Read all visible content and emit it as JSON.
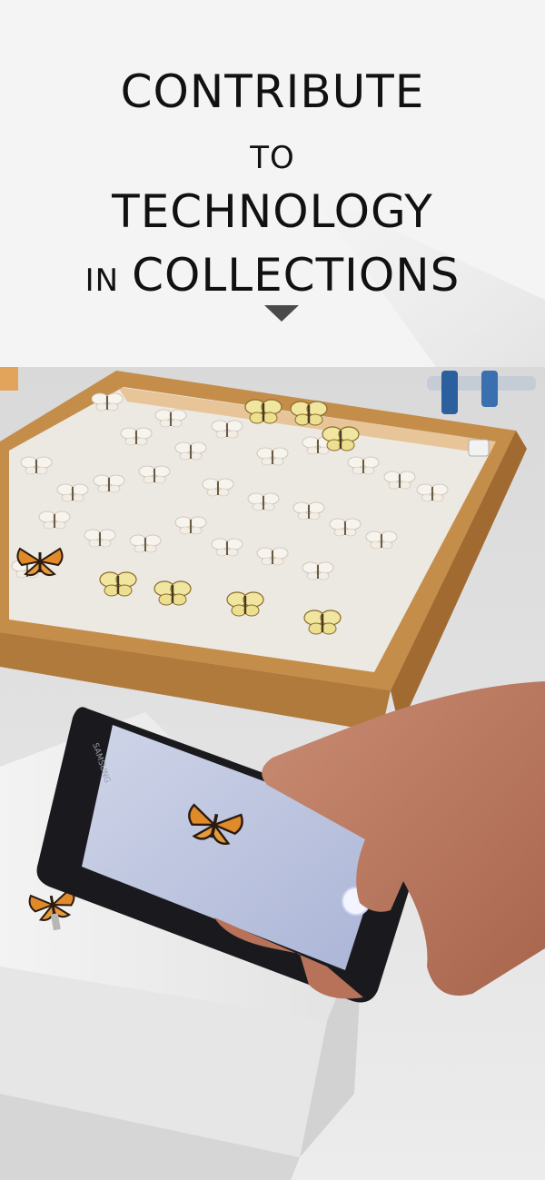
{
  "headline": {
    "line1": "CONTRIBUTE",
    "line2": "TO",
    "line3": "TECHNOLOGY",
    "line4_small": "IN",
    "line4_large": "COLLECTIONS"
  },
  "icons": {
    "scroll_indicator": "down-arrow-icon"
  },
  "photo": {
    "phone_brand": "SAMSUNG"
  },
  "colors": {
    "background": "#f4f4f4",
    "text": "#111111",
    "arrow": "#4a4a4a"
  }
}
